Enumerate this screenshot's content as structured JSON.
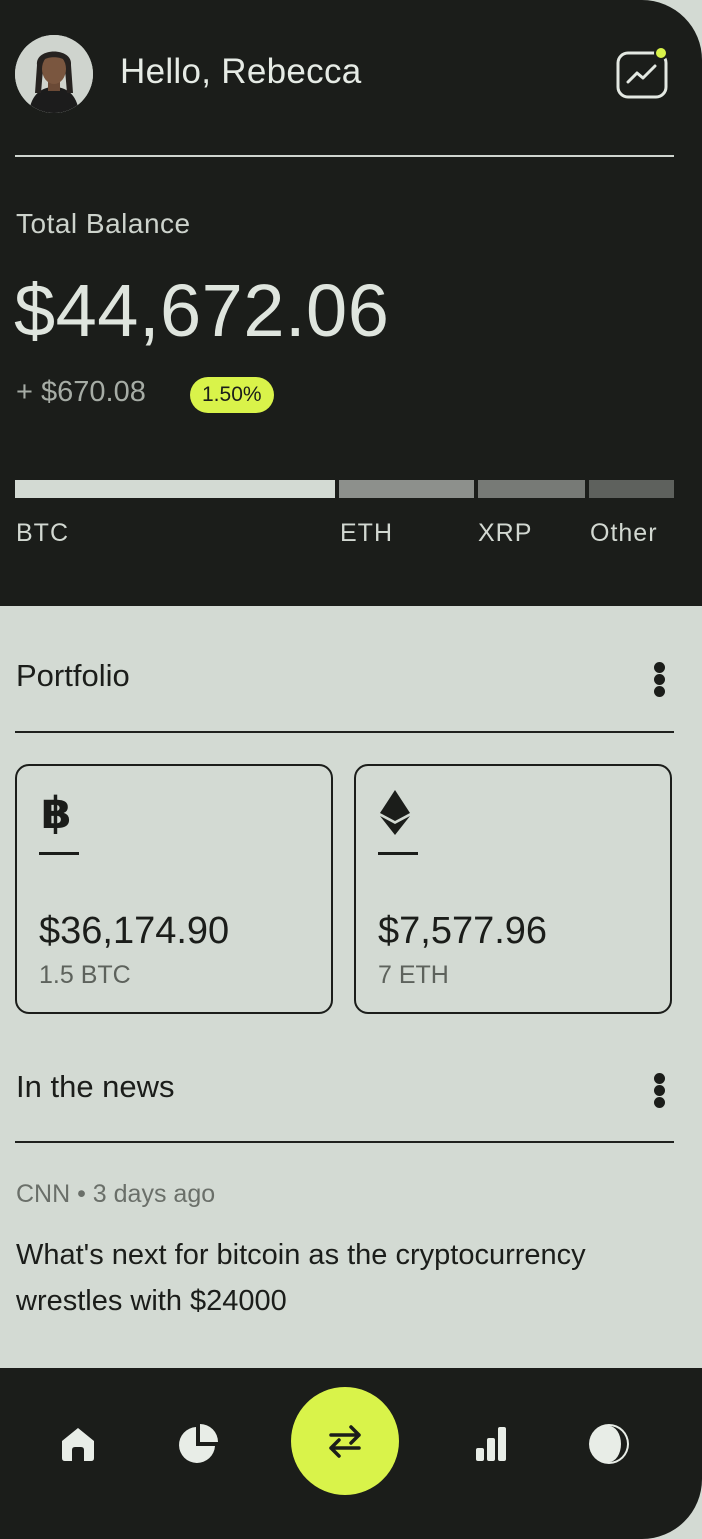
{
  "header": {
    "greeting": "Hello, Rebecca",
    "accent_color": "#d9f34a"
  },
  "balance": {
    "label": "Total Balance",
    "amount": "$44,672.06",
    "change": "+ $670.08",
    "change_percent": "1.50%"
  },
  "allocation": [
    {
      "label": "BTC",
      "color": "#d3dad3"
    },
    {
      "label": "ETH",
      "color": "#8d908c"
    },
    {
      "label": "XRP",
      "color": "#777a76"
    },
    {
      "label": "Other",
      "color": "#5e615d"
    }
  ],
  "portfolio": {
    "title": "Portfolio",
    "cards": [
      {
        "icon": "bitcoin-icon",
        "value": "$36,174.90",
        "amount": "1.5 BTC"
      },
      {
        "icon": "ethereum-icon",
        "value": "$7,577.96",
        "amount": "7 ETH"
      }
    ]
  },
  "news": {
    "title": "In the news",
    "items": [
      {
        "source": "CNN • 3 days ago",
        "headline": "What's next for bitcoin as the cryptocurrency wrestles with $24000"
      }
    ]
  },
  "nav": {
    "items": [
      "home-icon",
      "pie-chart-icon",
      "swap-icon",
      "bar-chart-icon",
      "theme-icon"
    ]
  }
}
